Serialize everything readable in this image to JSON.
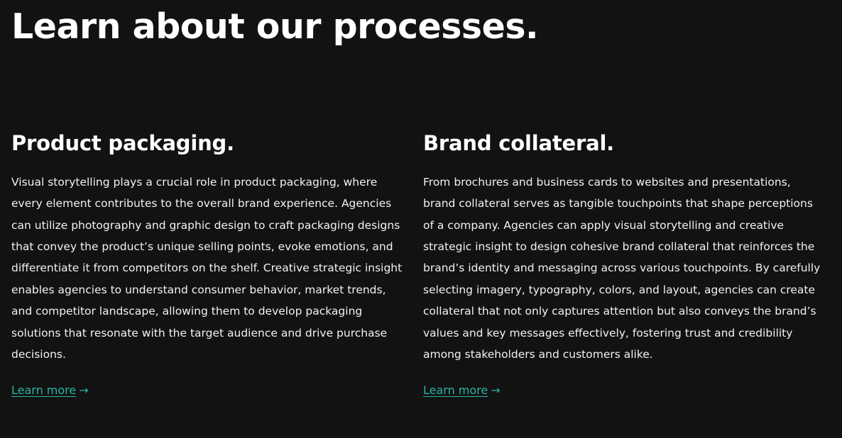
{
  "header": {
    "title": "Learn about our processes."
  },
  "sections": [
    {
      "heading": "Product packaging.",
      "body": "Visual storytelling plays a crucial role in product packaging, where every element contributes to the overall brand experience. Agencies can utilize photography and graphic design to craft packaging designs that convey the product’s unique selling points, evoke emotions, and differentiate it from competitors on the shelf. Creative strategic insight enables agencies to understand consumer behavior, market trends, and competitor landscape, allowing them to develop packaging solutions that resonate with the target audience and drive purchase decisions.",
      "link_label": "Learn more"
    },
    {
      "heading": "Brand collateral.",
      "body": "From brochures and business cards to websites and presentations, brand collateral serves as tangible touchpoints that shape perceptions of a company. Agencies can apply visual storytelling and creative strategic insight to design cohesive brand collateral that reinforces the brand’s identity and messaging across various touchpoints. By carefully selecting imagery, typography, colors, and layout, agencies can create collateral that not only captures attention but also conveys the brand’s values and key messages effectively, fostering trust and credibility among stakeholders and customers alike.",
      "link_label": "Learn more"
    }
  ],
  "icons": {
    "arrow": "→",
    "arrow_name": "arrow-right-icon"
  },
  "colors": {
    "background": "#121212",
    "text": "#ffffff",
    "link": "#2bb5a7"
  }
}
